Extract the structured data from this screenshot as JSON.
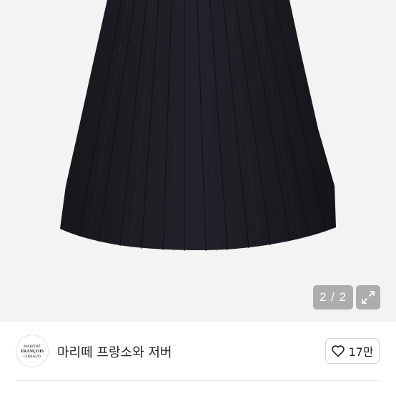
{
  "product": {
    "image_name": "black-pleated-skirt",
    "image_index": "2 / 2"
  },
  "brand": {
    "name": "마리떼 프랑소와 저버",
    "logo_lines": [
      "MARITHÉ",
      "FRANÇOIS",
      "GIRBAUD"
    ]
  },
  "like": {
    "count": "17만",
    "icon": "heart-outline-icon"
  },
  "icons": {
    "expand": "expand-arrows-icon"
  },
  "colors": {
    "image_background": "#f3f3f3",
    "skirt": "#1b1c20",
    "badge_background": "#9a9a9a"
  }
}
